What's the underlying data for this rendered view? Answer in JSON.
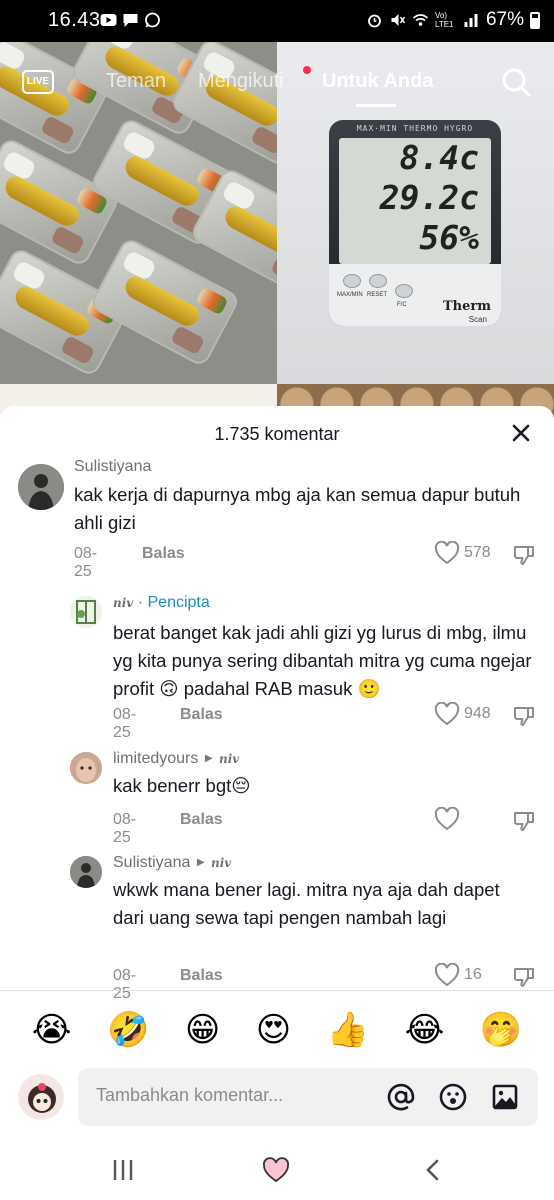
{
  "status_bar": {
    "time": "16.43",
    "battery": "67%",
    "network_label": "Vo) LTE1"
  },
  "top_nav": {
    "live_label": "LIVE",
    "tabs": [
      {
        "label": "Teman",
        "active": false
      },
      {
        "label": "Mengikuti",
        "active": false
      },
      {
        "label": "Untuk Anda",
        "active": true
      }
    ]
  },
  "video": {
    "thermometer": {
      "header": "MAX·MIN THERMO HYGRO",
      "reading_1": "8.4c",
      "reading_2": "29.2c",
      "reading_3": "56%",
      "buttons": [
        "MAX/MIN",
        "RESET",
        "F/C"
      ],
      "brand": "Therm",
      "brand_sub": "Scan"
    }
  },
  "comments_sheet": {
    "title": "1.735 komentar",
    "comments": [
      {
        "username": "Sulistiyana",
        "text": "kak kerja di dapurnya mbg aja kan semua dapur butuh ahli gizi",
        "date": "08-25",
        "reply_label": "Balas",
        "likes": "578"
      },
      {
        "username": "niv",
        "badge": "· Pencipta",
        "text": "berat banget kak jadi ahli gizi yg lurus di mbg, ilmu yg kita punya sering dibantah mitra yg cuma ngejar profit 🙃 padahal RAB masuk 🙂",
        "date": "08-25",
        "reply_label": "Balas",
        "likes": "948"
      },
      {
        "username": "limitedyours",
        "reply_to": "niv",
        "text": "kak benerr bgt😔",
        "date": "08-25",
        "reply_label": "Balas",
        "likes": ""
      },
      {
        "username": "Sulistiyana",
        "reply_to": "niv",
        "text": "wkwk mana bener lagi. mitra nya aja dah dapet dari uang sewa tapi pengen nambah lagi",
        "date": "08-25",
        "reply_label": "Balas",
        "likes": "16"
      }
    ],
    "quick_emojis": [
      "😭",
      "🤣",
      "😁",
      "😍",
      "👍",
      "😂",
      "🤭"
    ],
    "input_placeholder": "Tambahkan komentar..."
  },
  "colors": {
    "creator_badge": "#1b8fb8",
    "live_dot": "#fe2c55",
    "text_primary": "#161823",
    "text_secondary": "#8a8b91"
  }
}
